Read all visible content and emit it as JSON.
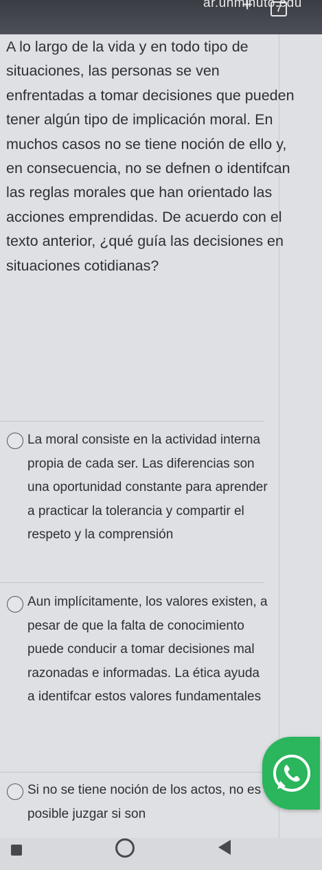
{
  "browser": {
    "url_fragment": "ar.unminuto.edu",
    "tab_count": "7"
  },
  "question": {
    "text": "A lo largo de la vida y en todo tipo de situaciones, las personas se ven enfrentadas a tomar decisiones que pueden tener algún tipo de implicación moral. En muchos casos no se tiene noción de ello y, en consecuencia, no se defnen o identifcan las reglas morales que han orientado las acciones emprendidas. De acuerdo con el texto anterior, ¿qué guía las decisiones en situaciones cotidianas?"
  },
  "options": [
    {
      "text": "La moral consiste en la actividad interna propia de cada ser. Las diferencias son una oportunidad constante para aprender a practicar la tolerancia y compartir el respeto y la comprensión"
    },
    {
      "text": "Aun implícitamente, los valores existen, a pesar de que la falta de conocimiento puede conducir a tomar decisiones mal razonadas e informadas. La ética ayuda a identifcar estos valores fundamentales"
    },
    {
      "text": "Si no se tiene noción de los actos, no es posible juzgar si son"
    }
  ],
  "icons": {
    "floating": "whatsapp-icon",
    "new_tab": "plus-icon",
    "tabs": "tabs-counter-icon",
    "nav_recent": "recent-apps-icon",
    "nav_home": "home-icon",
    "nav_back": "back-icon"
  },
  "colors": {
    "whatsapp_green": "#2bb55c",
    "browser_bar": "#3a3d44"
  }
}
